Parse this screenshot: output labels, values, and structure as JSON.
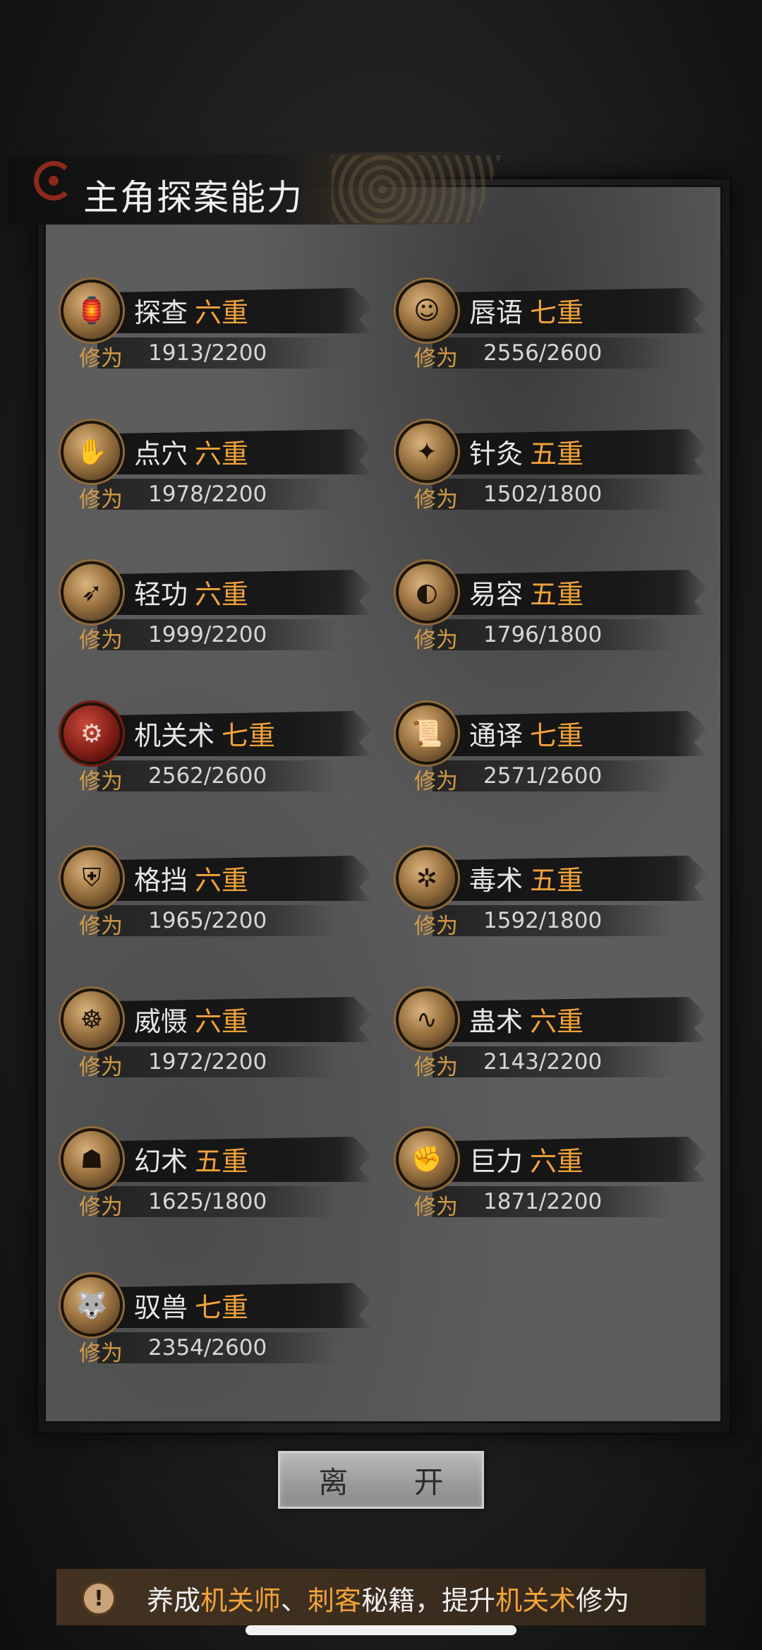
{
  "title": "主角探案能力",
  "progress_label": "修为",
  "skills": [
    {
      "name": "探查",
      "level": "六重",
      "value": "1913/2200",
      "icon": "lantern-icon"
    },
    {
      "name": "唇语",
      "level": "七重",
      "value": "2556/2600",
      "icon": "mask-icon"
    },
    {
      "name": "点穴",
      "level": "六重",
      "value": "1978/2200",
      "icon": "pressure-point-icon"
    },
    {
      "name": "针灸",
      "level": "五重",
      "value": "1502/1800",
      "icon": "needle-icon"
    },
    {
      "name": "轻功",
      "level": "六重",
      "value": "1999/2200",
      "icon": "leap-icon"
    },
    {
      "name": "易容",
      "level": "五重",
      "value": "1796/1800",
      "icon": "disguise-icon"
    },
    {
      "name": "机关术",
      "level": "七重",
      "value": "2562/2600",
      "icon": "mechanism-icon"
    },
    {
      "name": "通译",
      "level": "七重",
      "value": "2571/2600",
      "icon": "scroll-icon"
    },
    {
      "name": "格挡",
      "level": "六重",
      "value": "1965/2200",
      "icon": "block-icon"
    },
    {
      "name": "毒术",
      "level": "五重",
      "value": "1592/1800",
      "icon": "spider-icon"
    },
    {
      "name": "威慑",
      "level": "六重",
      "value": "1972/2200",
      "icon": "intimidate-icon"
    },
    {
      "name": "蛊术",
      "level": "六重",
      "value": "2143/2200",
      "icon": "gu-worm-icon"
    },
    {
      "name": "幻术",
      "level": "五重",
      "value": "1625/1800",
      "icon": "hooded-figure-icon"
    },
    {
      "name": "巨力",
      "level": "六重",
      "value": "1871/2200",
      "icon": "fist-icon"
    },
    {
      "name": "驭兽",
      "level": "七重",
      "value": "2354/2600",
      "icon": "beast-icon"
    }
  ],
  "leave_button": "离 开",
  "tip": {
    "icon": "alert-icon",
    "part1": "养成",
    "hl1": "机关师",
    "part2": "、",
    "hl2": "刺客",
    "part3": "秘籍，提升",
    "hl3": "机关术",
    "part4": "修为"
  },
  "colors": {
    "accent": "#f2a33a",
    "label": "#d29a45",
    "panel": "#5d5d5d"
  }
}
